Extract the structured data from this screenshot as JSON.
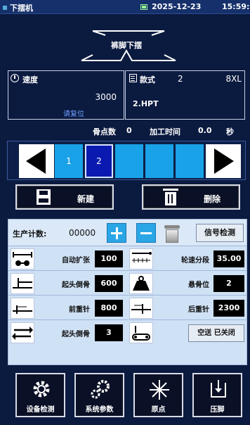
{
  "status": {
    "app_name": "下摆机",
    "date": "2025-12-23",
    "time": "15:59:06",
    "battery_color": "#99ff99"
  },
  "mode": {
    "label": "裤脚下摆"
  },
  "speed": {
    "label": "速度",
    "value": "3000",
    "reset_hint": "请复位"
  },
  "style": {
    "label": "款式",
    "number": "2",
    "size": "8XL",
    "file": "2.HPT"
  },
  "stats": {
    "bone_count_label": "骨点数",
    "bone_count": "0",
    "process_time_label": "加工时间",
    "process_time": "0.0",
    "time_unit": "秒"
  },
  "steps": {
    "cells": [
      {
        "label": "1",
        "active": false
      },
      {
        "label": "2",
        "active": true
      },
      {
        "label": "",
        "active": false
      },
      {
        "label": "",
        "active": false
      },
      {
        "label": "",
        "active": false
      },
      {
        "label": "",
        "active": false
      }
    ]
  },
  "actions": {
    "new_label": "新建",
    "delete_label": "删除"
  },
  "production": {
    "label": "生产计数:",
    "value": "00000",
    "signal_label": "信号检测"
  },
  "params": {
    "auto_expand_label": "自动扩张",
    "auto_expand_value": "100",
    "wheel_speed_label": "轮速分段",
    "wheel_speed_value": "35.00",
    "start_reverse_label": "起头倒骨",
    "start_reverse_value": "600",
    "hang_bone_label": "悬骨位",
    "hang_bone_value": "2",
    "front_stitch_label": "前重针",
    "front_stitch_value": "800",
    "rear_stitch_label": "后重针",
    "rear_stitch_value": "2300",
    "start_reverse2_label": "起头倒骨",
    "start_reverse2_value": "3",
    "delay_label": "空送 已关闭"
  },
  "nav": {
    "device_check": "设备检测",
    "system_params": "系统参数",
    "origin": "原点",
    "presser": "压脚"
  },
  "colors": {
    "background": "#0b1a3f",
    "accent_blue": "#19a2e8",
    "active_blue": "#0a1ab0",
    "panel": "#cfe1f5"
  }
}
